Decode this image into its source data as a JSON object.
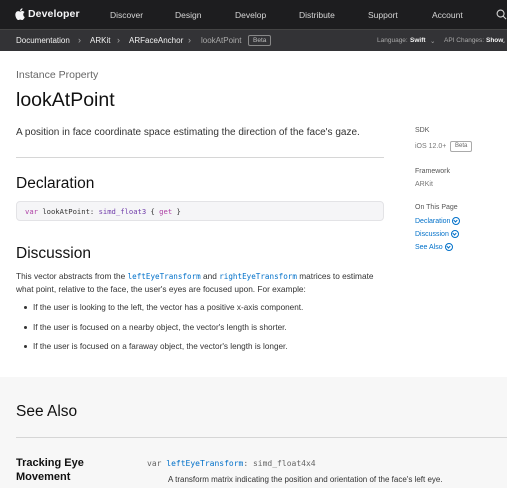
{
  "globalnav": {
    "brand": "Developer",
    "items": [
      "Discover",
      "Design",
      "Develop",
      "Distribute",
      "Support",
      "Account"
    ]
  },
  "localnav": {
    "breadcrumbs": [
      "Documentation",
      "ARKit",
      "ARFaceAnchor",
      "lookAtPoint"
    ],
    "beta": "Beta",
    "language_label": "Language:",
    "language_value": "Swift",
    "api_changes_label": "API Changes:",
    "api_changes_value": "Show"
  },
  "main": {
    "eyebrow": "Instance Property",
    "title": "lookAtPoint",
    "abstract": "A position in face coordinate space estimating the direction of the face's gaze.",
    "declaration_heading": "Declaration",
    "declaration": {
      "keyword": "var",
      "name": "lookAtPoint",
      "colon": ":",
      "type": "simd_float3",
      "open": "{",
      "getter": "get",
      "close": "}"
    },
    "discussion_heading": "Discussion",
    "discussion": {
      "part1": "This vector abstracts from the ",
      "link1": "leftEyeTransform",
      "part2": " and ",
      "link2": "rightEyeTransform",
      "part3": " matrices to estimate what point, relative to the face, the user's eyes are focused upon. For example:"
    },
    "bullets": [
      "If the user is looking to the left, the vector has a positive x-axis component.",
      "If the user is focused on a nearby object, the vector's length is shorter.",
      "If the user is focused on a faraway object, the vector's length is longer."
    ]
  },
  "sidebar": {
    "sdk_label": "SDK",
    "sdk_value": "iOS 12.0+",
    "sdk_beta": "Beta",
    "framework_label": "Framework",
    "framework_value": "ARKit",
    "on_this_page_label": "On This Page",
    "links": [
      "Declaration",
      "Discussion",
      "See Also"
    ]
  },
  "see_also": {
    "heading": "See Also",
    "topic_title": "Tracking Eye Movement",
    "item": {
      "keyword": "var",
      "name": "leftEyeTransform",
      "type": ": simd_float4x4",
      "abstract": "A transform matrix indicating the position and orientation of the face's left eye."
    }
  }
}
